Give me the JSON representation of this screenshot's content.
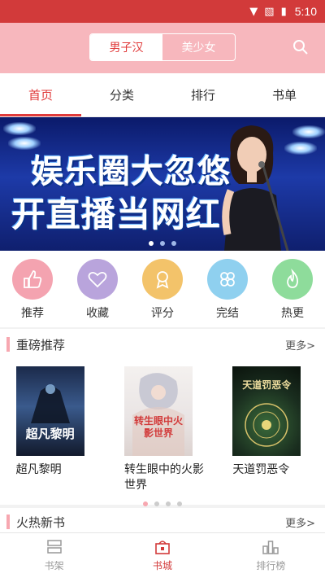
{
  "status_bar": {
    "time": "5:10",
    "icons": [
      "wifi-icon",
      "no-sim-icon",
      "battery-icon"
    ]
  },
  "header": {
    "segments": [
      {
        "label": "男子汉",
        "active": true
      },
      {
        "label": "美少女",
        "active": false
      }
    ],
    "search_icon": "search-icon"
  },
  "tabs": [
    {
      "label": "首页",
      "active": true
    },
    {
      "label": "分类",
      "active": false
    },
    {
      "label": "排行",
      "active": false
    },
    {
      "label": "书单",
      "active": false
    }
  ],
  "banner": {
    "line1": "娱乐圈大忽悠",
    "line2": "开直播当网红",
    "slide_count": 3,
    "active_slide": 1
  },
  "shortcuts": [
    {
      "label": "推荐",
      "icon": "thumbs-up-icon",
      "color": "#f4a3b0"
    },
    {
      "label": "收藏",
      "icon": "heart-icon",
      "color": "#b9a4dc"
    },
    {
      "label": "评分",
      "icon": "medal-icon",
      "color": "#f3c36a"
    },
    {
      "label": "完结",
      "icon": "clover-icon",
      "color": "#8fd0ef"
    },
    {
      "label": "热更",
      "icon": "flame-icon",
      "color": "#8edc9b"
    }
  ],
  "featured": {
    "title": "重磅推荐",
    "more": "更多>",
    "books": [
      {
        "name": "超凡黎明",
        "cover_text": "超凡黎明"
      },
      {
        "name": "转生眼中的火影世界",
        "cover_text": "转生眼中火影世界"
      },
      {
        "name": "天道罚恶令",
        "cover_text": "天道罚恶令"
      }
    ],
    "pager_count": 4,
    "pager_active": 0
  },
  "hot": {
    "title": "火热新书",
    "more": "更多>"
  },
  "bottom_nav": [
    {
      "label": "书架",
      "icon": "bookshelf-icon",
      "active": false
    },
    {
      "label": "书城",
      "icon": "store-icon",
      "active": true
    },
    {
      "label": "排行榜",
      "icon": "ranking-icon",
      "active": false
    }
  ],
  "colors": {
    "accent": "#d23a3a",
    "header_pink": "#f7b7bd"
  }
}
